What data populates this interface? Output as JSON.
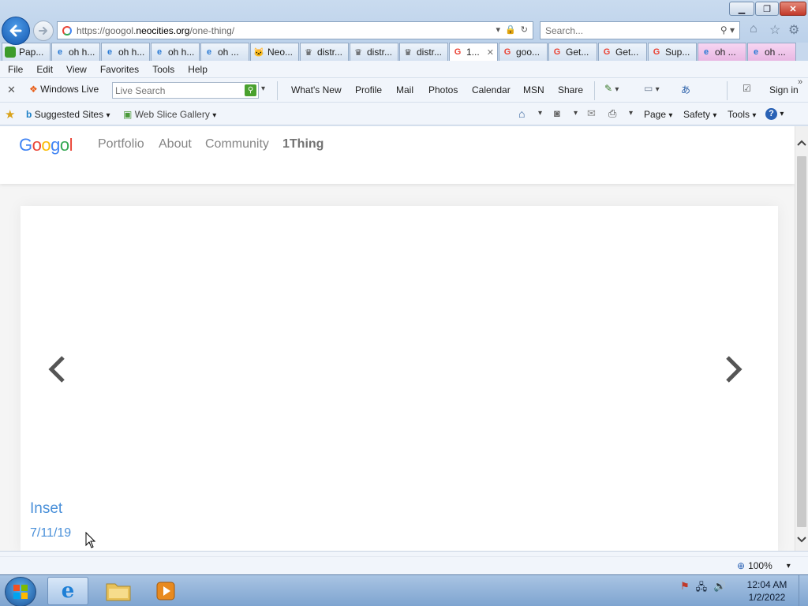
{
  "browser": {
    "url_prefix": "https://googol.",
    "url_host": "neocities.org",
    "url_path": "/one-thing/",
    "search_placeholder": "Search...",
    "tabs": [
      {
        "label": "Pap...",
        "icon": "green-leaf-icon"
      },
      {
        "label": "oh h...",
        "icon": "ie-icon"
      },
      {
        "label": "oh h...",
        "icon": "ie-icon"
      },
      {
        "label": "oh h...",
        "icon": "ie-icon"
      },
      {
        "label": "oh ...",
        "icon": "ie-icon"
      },
      {
        "label": "Neo...",
        "icon": "cat-icon"
      },
      {
        "label": "distr...",
        "icon": "sprite-icon"
      },
      {
        "label": "distr...",
        "icon": "sprite-icon"
      },
      {
        "label": "distr...",
        "icon": "sprite-icon"
      },
      {
        "label": "1...",
        "icon": "google-icon",
        "active": true
      },
      {
        "label": "goo...",
        "icon": "google-icon"
      },
      {
        "label": "Get...",
        "icon": "google-icon"
      },
      {
        "label": "Get...",
        "icon": "google-icon"
      },
      {
        "label": "Sup...",
        "icon": "google-icon"
      },
      {
        "label": "oh ...",
        "icon": "ie-icon"
      },
      {
        "label": "oh ...",
        "icon": "ie-icon"
      }
    ],
    "menu": [
      "File",
      "Edit",
      "View",
      "Favorites",
      "Tools",
      "Help"
    ],
    "wl_toolbar": {
      "brand": "Windows Live",
      "search_placeholder": "Live Search",
      "links": [
        "What's New",
        "Profile",
        "Mail",
        "Photos",
        "Calendar",
        "MSN",
        "Share"
      ],
      "sign_in": "Sign in"
    },
    "favorites_bar": {
      "suggested": "Suggested Sites",
      "web_slice": "Web Slice Gallery",
      "page": "Page",
      "safety": "Safety",
      "tools": "Tools"
    },
    "zoom": "100%"
  },
  "site": {
    "logo": {
      "g1": "G",
      "o1": "o",
      "o2": "o",
      "g2": "g",
      "o3": "o",
      "l": "l"
    },
    "nav": [
      "Portfolio",
      "About",
      "Community",
      "1Thing"
    ],
    "slide": {
      "title": "Inset",
      "date": "7/11/19"
    }
  },
  "taskbar": {
    "time": "12:04 AM",
    "date": "1/2/2022"
  }
}
